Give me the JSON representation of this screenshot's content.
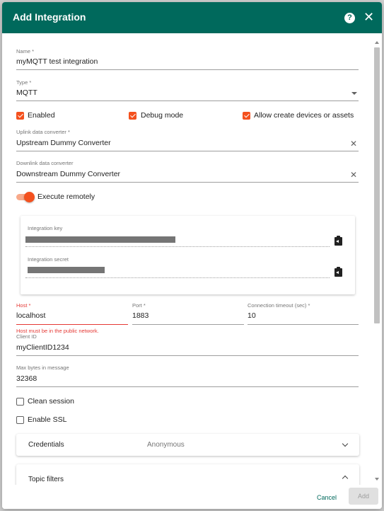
{
  "dialog": {
    "title": "Add Integration"
  },
  "fields": {
    "name": {
      "label": "Name *",
      "value": "myMQTT test integration"
    },
    "type": {
      "label": "Type *",
      "value": "MQTT"
    },
    "uplink": {
      "label": "Uplink data converter *",
      "value": "Upstream Dummy Converter"
    },
    "downlink": {
      "label": "Downlink data converter",
      "value": "Downstream Dummy Converter"
    },
    "host": {
      "label": "Host *",
      "value": "localhost",
      "error": "Host must be in the public network."
    },
    "port": {
      "label": "Port *",
      "value": "1883"
    },
    "timeout": {
      "label": "Connection timeout (sec) *",
      "value": "10"
    },
    "client_id": {
      "label": "Client ID",
      "value": "myClientID1234"
    },
    "max_bytes": {
      "label": "Max bytes in message",
      "value": "32368"
    }
  },
  "checkboxes": {
    "enabled": {
      "label": "Enabled",
      "checked": true
    },
    "debug": {
      "label": "Debug mode",
      "checked": true
    },
    "allow_create": {
      "label": "Allow create devices or assets",
      "checked": true
    },
    "clean_session": {
      "label": "Clean session",
      "checked": false
    },
    "enable_ssl": {
      "label": "Enable SSL",
      "checked": false
    }
  },
  "toggle": {
    "label": "Execute remotely",
    "on": true
  },
  "remote_panel": {
    "key_label": "Integration key",
    "secret_label": "Integration secret"
  },
  "credentials": {
    "title": "Credentials",
    "value": "Anonymous"
  },
  "topic_filters": {
    "title": "Topic filters"
  },
  "footer": {
    "cancel": "Cancel",
    "add": "Add"
  },
  "colors": {
    "header": "#00695c",
    "accent": "#f4511e",
    "error": "#e53935"
  },
  "icons": [
    "help-icon",
    "close-icon",
    "dropdown-arrow-icon",
    "clear-icon",
    "clipboard-icon",
    "chevron-down-icon",
    "chevron-up-icon"
  ]
}
